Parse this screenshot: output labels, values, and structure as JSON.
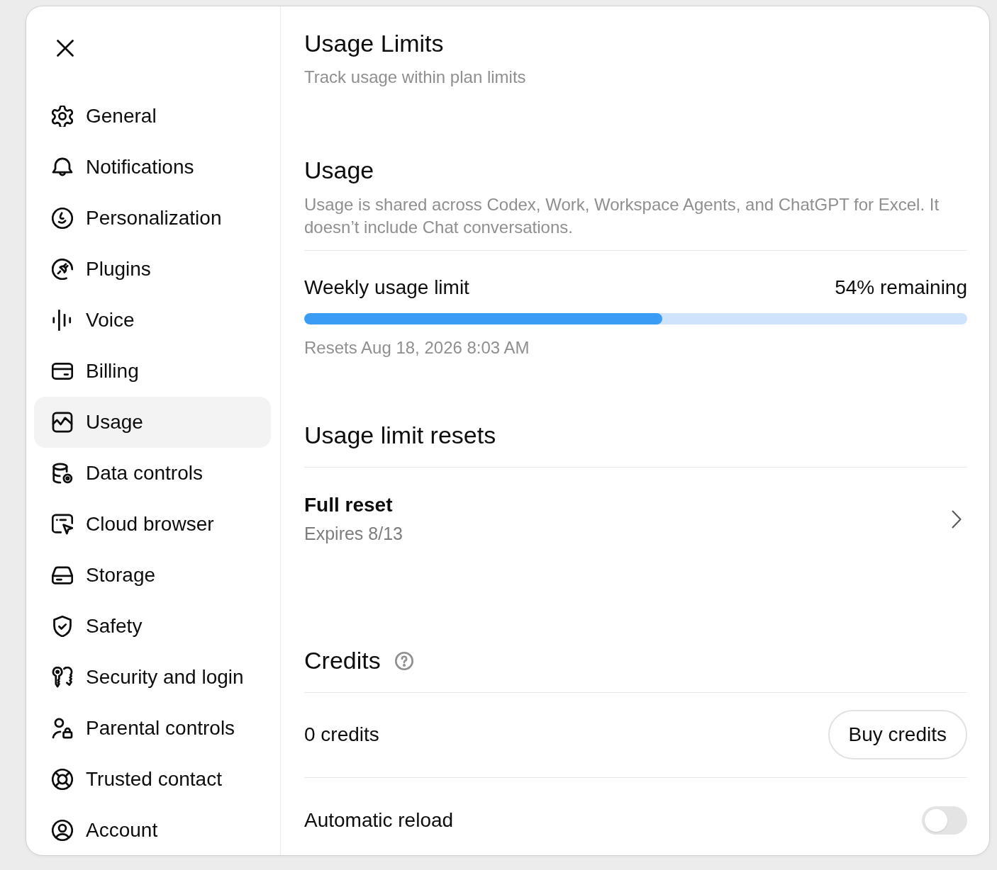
{
  "sidebar": {
    "items": [
      {
        "label": "General",
        "selected": false
      },
      {
        "label": "Notifications",
        "selected": false
      },
      {
        "label": "Personalization",
        "selected": false
      },
      {
        "label": "Plugins",
        "selected": false
      },
      {
        "label": "Voice",
        "selected": false
      },
      {
        "label": "Billing",
        "selected": false
      },
      {
        "label": "Usage",
        "selected": true
      },
      {
        "label": "Data controls",
        "selected": false
      },
      {
        "label": "Cloud browser",
        "selected": false
      },
      {
        "label": "Storage",
        "selected": false
      },
      {
        "label": "Safety",
        "selected": false
      },
      {
        "label": "Security and login",
        "selected": false
      },
      {
        "label": "Parental controls",
        "selected": false
      },
      {
        "label": "Trusted contact",
        "selected": false
      },
      {
        "label": "Account",
        "selected": false
      }
    ]
  },
  "main": {
    "title": "Usage Limits",
    "subtitle": "Track usage within plan limits",
    "usage": {
      "heading": "Usage",
      "description": "Usage is shared across Codex, Work, Workspace Agents, and ChatGPT for Excel. It doesn’t include Chat conversations.",
      "meter": {
        "label": "Weekly usage limit",
        "reading": "54% remaining",
        "level": 0.54,
        "note": "Resets Aug 18, 2026 8:03 AM"
      }
    },
    "resets": {
      "heading": "Usage limit resets",
      "items": [
        {
          "title": "Full reset",
          "subtitle": "Expires 8/13"
        }
      ]
    },
    "credits": {
      "heading": "Credits",
      "balance": "0 credits",
      "buy_button": "Buy credits",
      "auto_reload": {
        "label": "Automatic reload",
        "on": false
      }
    }
  }
}
